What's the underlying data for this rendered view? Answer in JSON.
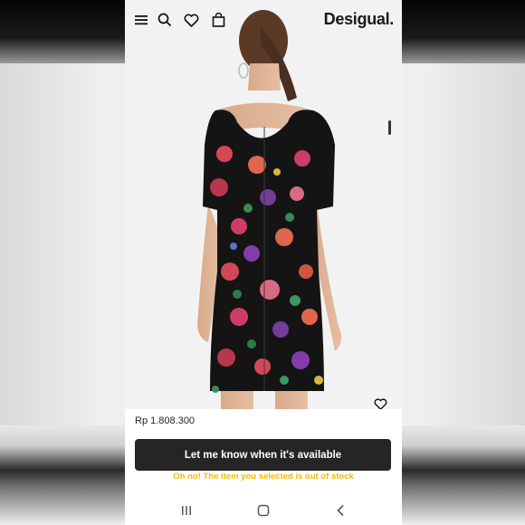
{
  "app": {
    "brand": "Desigual."
  },
  "header": {
    "menu_icon": "hamburger-menu-icon",
    "search_icon": "search-icon",
    "wishlist_icon": "heart-icon",
    "bag_icon": "shopping-bag-icon"
  },
  "product": {
    "image_description_icon": "product-photo",
    "favorite_icon": "heart-outline-icon",
    "price": "Rp 1.808.300"
  },
  "actions": {
    "notify_label": "Let me know when it's available",
    "out_of_stock_message": "Oh no! The item you selected is out of stock"
  },
  "system_nav": {
    "recents_icon": "recent-apps-icon",
    "home_icon": "home-icon",
    "back_icon": "back-icon"
  },
  "colors": {
    "button_bg": "#252525",
    "warning_text": "#f0b90b",
    "dress_base": "#141414"
  }
}
